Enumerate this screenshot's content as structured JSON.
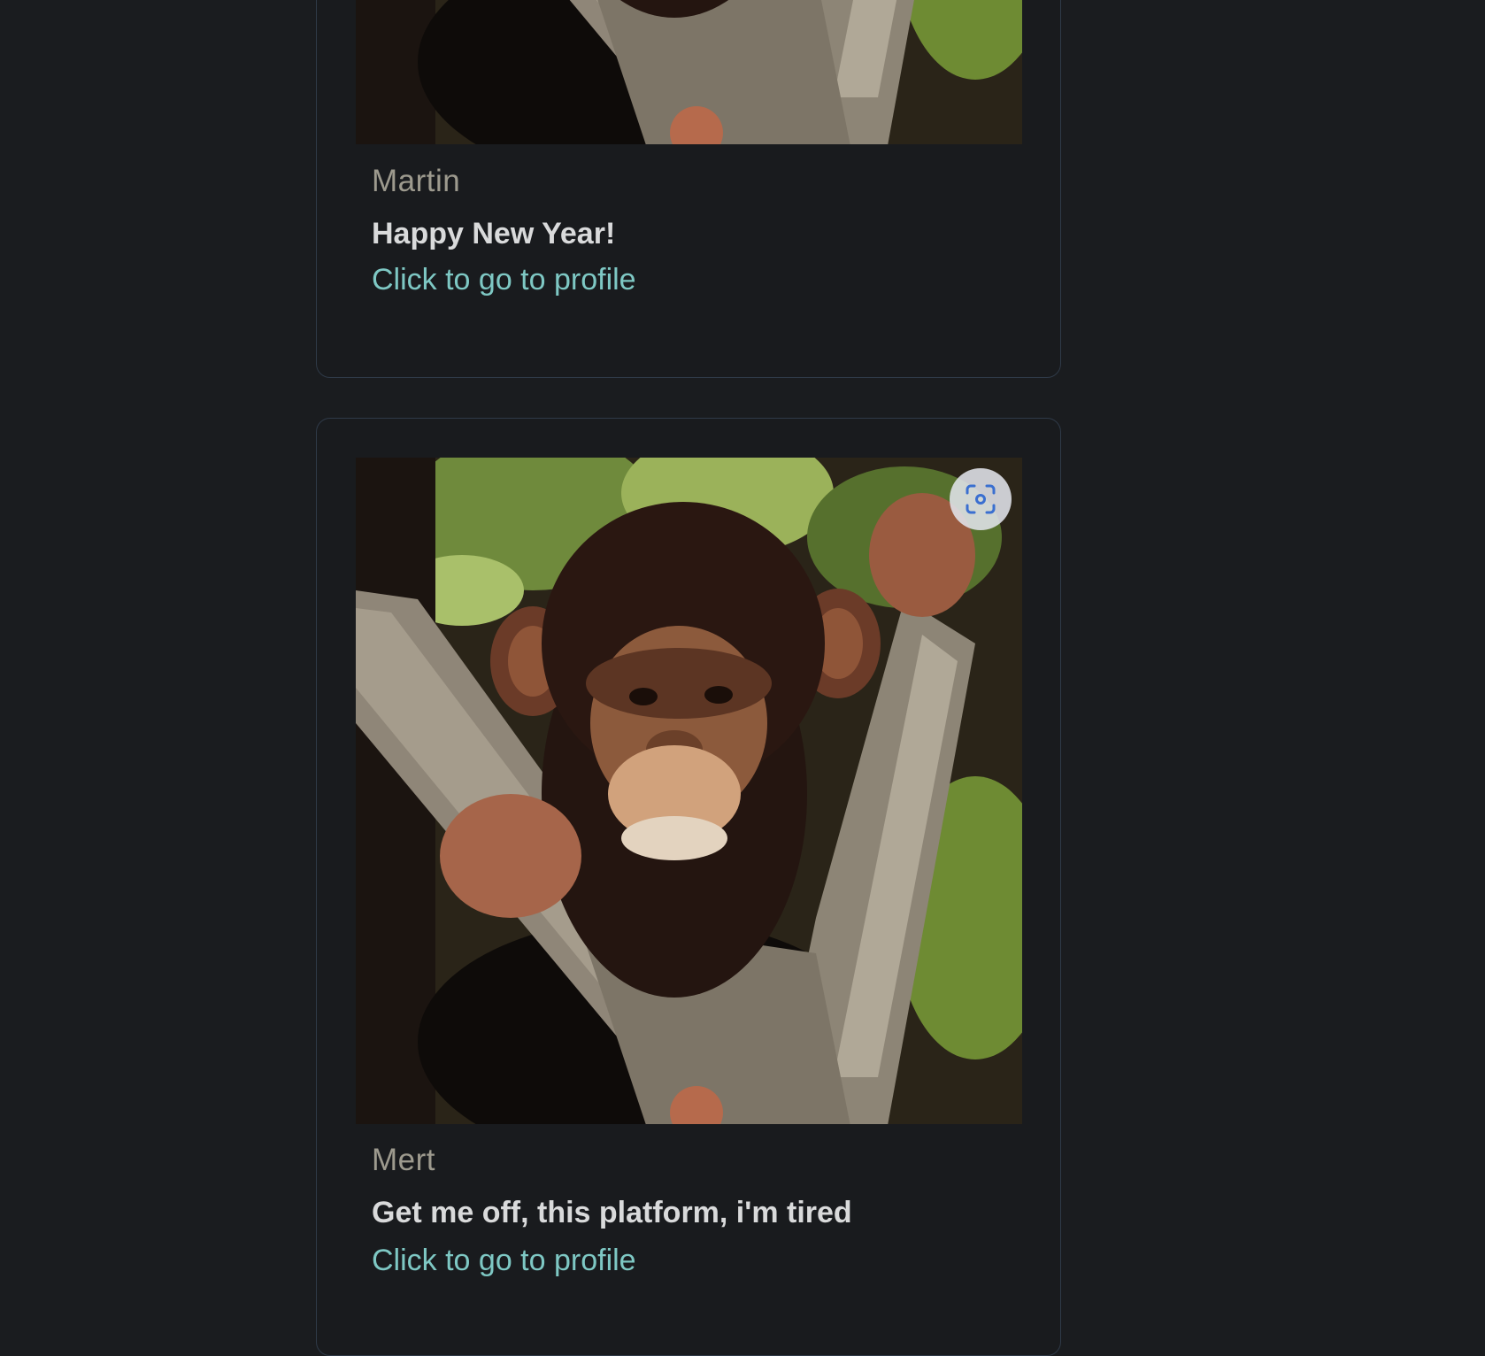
{
  "posts": [
    {
      "author": "Martin",
      "message": "Happy New Year!",
      "link_label": "Click to go to profile",
      "image": "chimpanzee-in-tree-photo"
    },
    {
      "author": "Mert",
      "message": "Get me off, this platform, i'm tired",
      "link_label": "Click to go to profile",
      "image": "chimpanzee-in-tree-photo",
      "overlay_icon": "visual-lookup-icon"
    }
  ],
  "colors": {
    "background": "#1a1c1f",
    "card_border": "#2f3a48",
    "author": "#9d9a8e",
    "message": "#d9dadb",
    "link": "#7ec8c4"
  }
}
